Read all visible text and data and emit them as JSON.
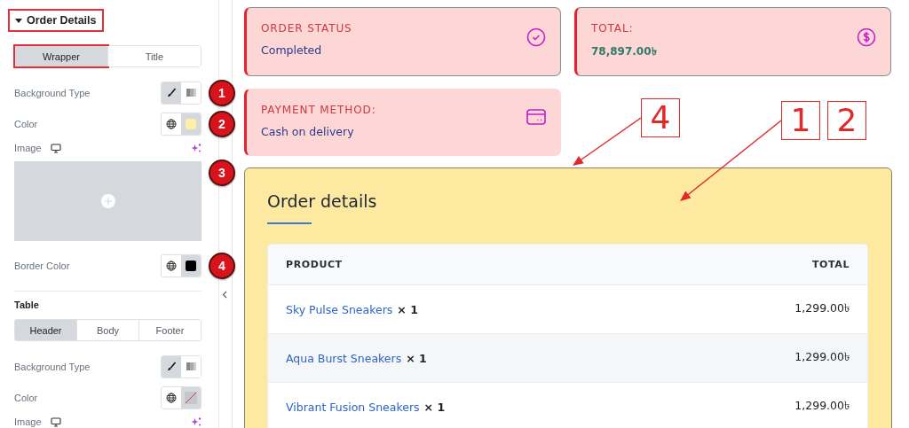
{
  "sidebar": {
    "sections": [
      {
        "kind": "section",
        "title": "Order Details",
        "expanded": true,
        "highlighted": true,
        "tabs": [
          {
            "label": "Wrapper",
            "selected": true,
            "highlighted": true
          },
          {
            "label": "Title",
            "selected": false,
            "highlighted": false
          }
        ],
        "controls": [
          {
            "kind": "background_type",
            "label": "Background Type",
            "marker": "1",
            "options": [
              {
                "selected": true
              },
              {
                "selected": false
              }
            ]
          },
          {
            "kind": "color",
            "label": "Color",
            "marker": "2",
            "color": "#fcefa6"
          },
          {
            "kind": "image",
            "label": "Image",
            "marker": "3",
            "uploader": true
          },
          {
            "kind": "color",
            "label": "Border Color",
            "marker": "4",
            "color": "#000000"
          }
        ]
      },
      {
        "kind": "group",
        "title": "Table",
        "tabs": [
          {
            "label": "Header",
            "selected": true,
            "highlighted": false
          },
          {
            "label": "Body",
            "selected": false,
            "highlighted": false
          },
          {
            "label": "Footer",
            "selected": false,
            "highlighted": false
          }
        ],
        "controls": [
          {
            "kind": "background_type",
            "label": "Background Type",
            "options": [
              {
                "selected": true
              },
              {
                "selected": false
              }
            ]
          },
          {
            "kind": "color",
            "label": "Color"
          },
          {
            "kind": "image",
            "label": "Image"
          }
        ]
      }
    ]
  },
  "cards": [
    {
      "kind": "status",
      "label": "ORDER STATUS",
      "value": "Completed",
      "outlined": true
    },
    {
      "kind": "total",
      "label": "TOTAL:",
      "value": "78,897.00৳",
      "outlined": true
    },
    {
      "kind": "payment",
      "label": "PAYMENT METHOD:",
      "value": "Cash on delivery",
      "outlined": false
    }
  ],
  "order_details": {
    "title": "Order details",
    "columns": [
      "PRODUCT",
      "TOTAL"
    ],
    "rows": [
      {
        "product": "Sky Pulse Sneakers",
        "quantity": "× 1",
        "total": "1,299.00৳"
      },
      {
        "product": "Aqua Burst Sneakers",
        "quantity": "× 1",
        "total": "1,299.00৳"
      },
      {
        "product": "Vibrant Fusion Sneakers",
        "quantity": "× 1",
        "total": "1,299.00৳"
      }
    ]
  },
  "callouts": [
    {
      "label": "4"
    },
    {
      "label": "1"
    },
    {
      "label": "2"
    }
  ]
}
